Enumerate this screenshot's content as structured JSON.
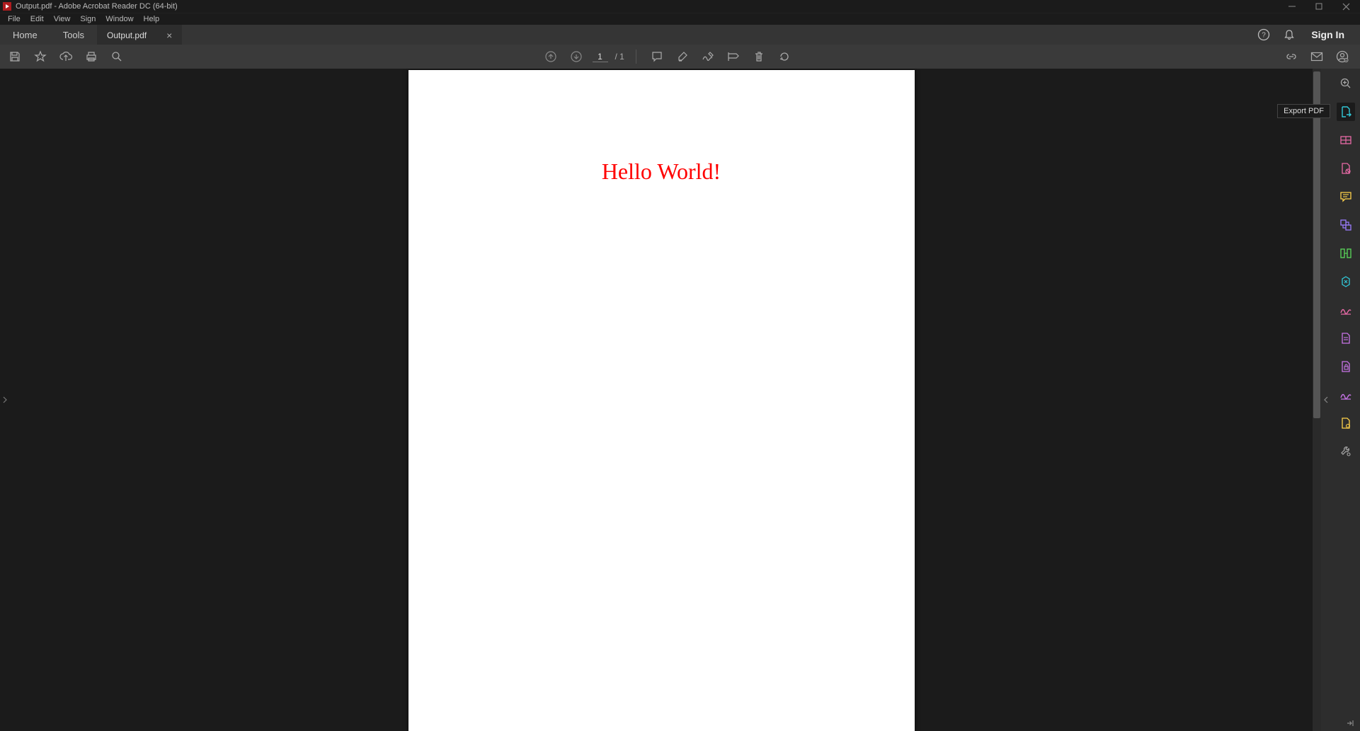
{
  "window": {
    "title": "Output.pdf - Adobe Acrobat Reader DC (64-bit)"
  },
  "menu": {
    "items": [
      "File",
      "Edit",
      "View",
      "Sign",
      "Window",
      "Help"
    ]
  },
  "tabs": {
    "home": "Home",
    "tools": "Tools",
    "document": "Output.pdf"
  },
  "header_right": {
    "sign_in": "Sign In"
  },
  "toolbar": {
    "page_current": "1",
    "page_total": "/ 1"
  },
  "document": {
    "content": "Hello World!"
  },
  "tooltip": {
    "export_pdf": "Export PDF"
  },
  "right_tools": {
    "items": [
      {
        "name": "search-plus-icon",
        "color": "#aaaaaa"
      },
      {
        "name": "export-pdf-icon",
        "color": "#31c8d8",
        "active": true
      },
      {
        "name": "edit-pdf-icon",
        "color": "#e86aa6"
      },
      {
        "name": "create-pdf-icon",
        "color": "#e86aa6"
      },
      {
        "name": "comment-icon",
        "color": "#ffd24a"
      },
      {
        "name": "combine-files-icon",
        "color": "#9a7cff"
      },
      {
        "name": "organize-pages-icon",
        "color": "#5ad85a"
      },
      {
        "name": "compress-pdf-icon",
        "color": "#31c8d8"
      },
      {
        "name": "fill-sign-icon",
        "color": "#e86aa6"
      },
      {
        "name": "convert-pdf-icon",
        "color": "#c874e8"
      },
      {
        "name": "protect-icon",
        "color": "#c874e8"
      },
      {
        "name": "sign-request-icon",
        "color": "#c874e8"
      },
      {
        "name": "stamp-icon",
        "color": "#ffd24a"
      },
      {
        "name": "more-tools-icon",
        "color": "#aaaaaa"
      }
    ]
  }
}
